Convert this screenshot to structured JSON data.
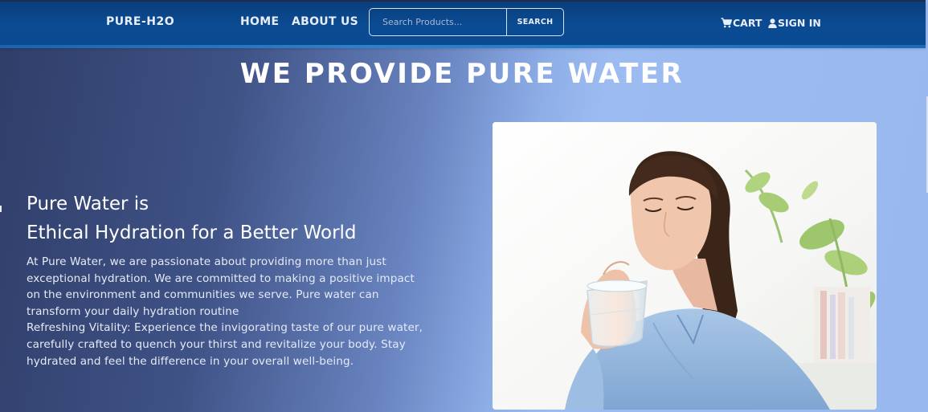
{
  "navbar": {
    "brand": "PURE-H2O",
    "links": [
      {
        "label": "HOME"
      },
      {
        "label": "ABOUT US"
      }
    ],
    "search": {
      "placeholder": "Search Products...",
      "value": "",
      "button_label": "SEARCH"
    },
    "cart": {
      "label": "CART",
      "icon": "shopping-cart-icon"
    },
    "signin": {
      "label": "SIGN IN",
      "icon": "user-icon"
    }
  },
  "hero": {
    "title": "WE PROVIDE PURE WATER",
    "headline_line1": "Pure Water is",
    "headline_line2": "Ethical Hydration for a Better World",
    "paragraph": [
      "At Pure Water, we are passionate about providing more than just",
      "exceptional hydration. We are committed to making a positive impact",
      "on the environment and communities we serve. Pure water can",
      "transform your daily hydration routine",
      "Refreshing Vitality: Experience the invigorating taste of our pure water,",
      "carefully crafted to quench your thirst and revitalize your body. Stay",
      "hydrated and feel the difference in your overall well-being."
    ],
    "image": "woman-drinking-water-photo"
  },
  "colors": {
    "navbar": "#0b4b93",
    "hero_dark": "#2f3d68",
    "hero_light": "#98b8ef",
    "text": "#ffffff"
  }
}
